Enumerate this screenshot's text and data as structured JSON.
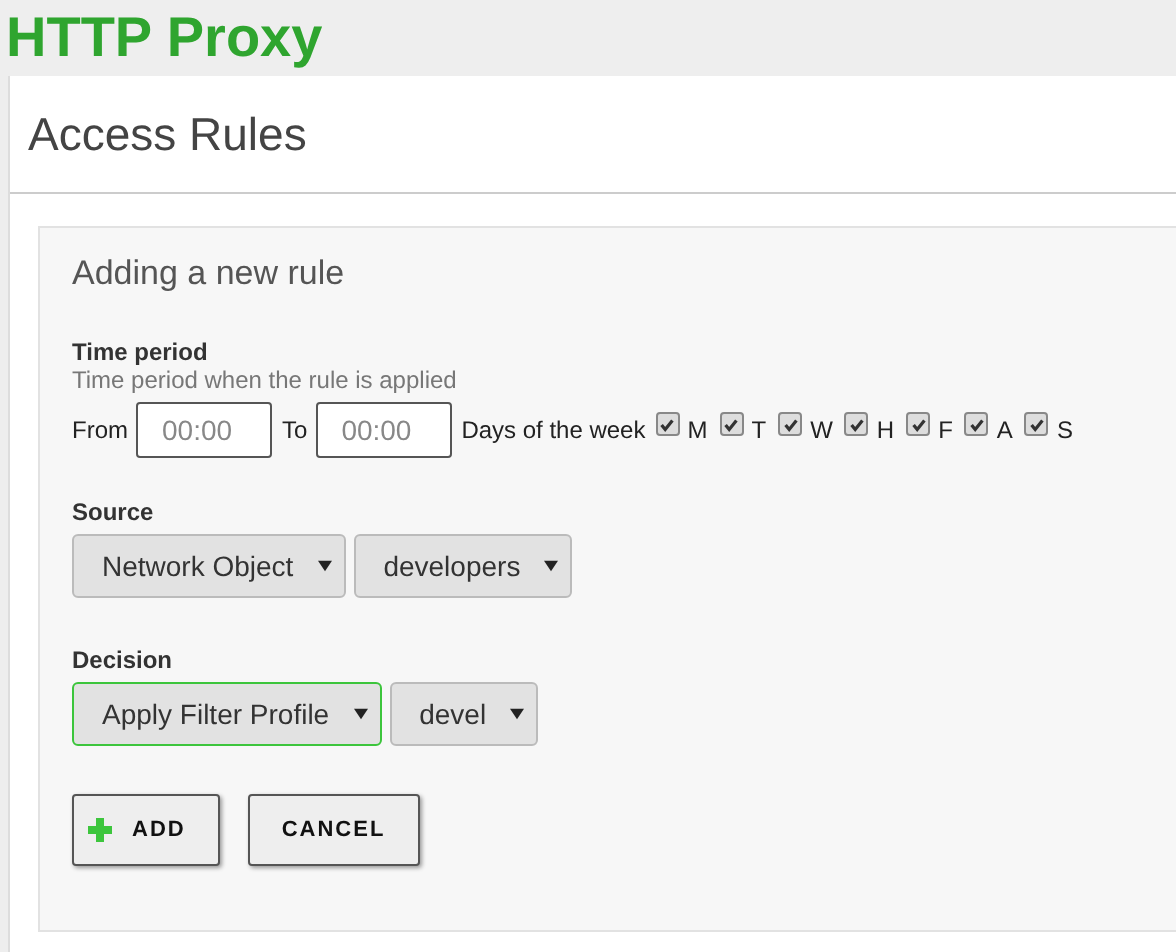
{
  "app_title": "HTTP Proxy",
  "page_title": "Access Rules",
  "form": {
    "title": "Adding a new rule",
    "time_period": {
      "label": "Time period",
      "help": "Time period when the rule is applied",
      "from_label": "From",
      "from_placeholder": "00:00",
      "to_label": "To",
      "to_placeholder": "00:00",
      "days_label": "Days of the week",
      "days": [
        {
          "label": "M",
          "checked": true
        },
        {
          "label": "T",
          "checked": true
        },
        {
          "label": "W",
          "checked": true
        },
        {
          "label": "H",
          "checked": true
        },
        {
          "label": "F",
          "checked": true
        },
        {
          "label": "A",
          "checked": true
        },
        {
          "label": "S",
          "checked": true
        }
      ]
    },
    "source": {
      "label": "Source",
      "selects": [
        {
          "value": "Network Object",
          "focused": false
        },
        {
          "value": "developers",
          "focused": false
        }
      ]
    },
    "decision": {
      "label": "Decision",
      "selects": [
        {
          "value": "Apply Filter Profile",
          "focused": true
        },
        {
          "value": "devel",
          "focused": false
        }
      ]
    },
    "buttons": [
      {
        "label": "ADD",
        "kind": "add"
      },
      {
        "label": "CANCEL",
        "kind": "cancel"
      }
    ]
  }
}
